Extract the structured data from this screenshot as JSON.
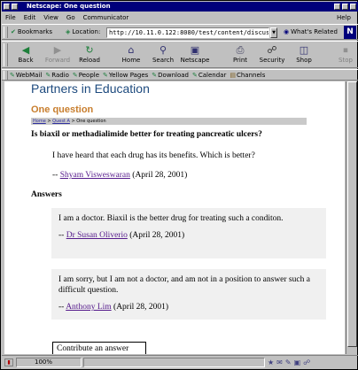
{
  "window": {
    "title": "Netscape: One question"
  },
  "menubar": {
    "items": [
      "File",
      "Edit",
      "View",
      "Go",
      "Communicator"
    ],
    "help": "Help"
  },
  "locationbar": {
    "bookmarks_label": "Bookmarks",
    "location_label": "Location:",
    "url": "http://10.11.0.122:8080/test/content/discus",
    "related_label": "What's Related"
  },
  "navtoolbar": {
    "buttons": [
      {
        "label": "Back",
        "icon": "back-arrow-icon",
        "enabled": true
      },
      {
        "label": "Forward",
        "icon": "forward-arrow-icon",
        "enabled": false
      },
      {
        "label": "Reload",
        "icon": "reload-icon",
        "enabled": true
      },
      {
        "label": "Home",
        "icon": "home-icon",
        "enabled": true
      },
      {
        "label": "Search",
        "icon": "search-icon",
        "enabled": true
      },
      {
        "label": "Netscape",
        "icon": "netscape-icon",
        "enabled": true
      },
      {
        "label": "Print",
        "icon": "print-icon",
        "enabled": true
      },
      {
        "label": "Security",
        "icon": "security-lock-icon",
        "enabled": true
      },
      {
        "label": "Shop",
        "icon": "shop-icon",
        "enabled": true
      },
      {
        "label": "Stop",
        "icon": "stop-icon",
        "enabled": false
      }
    ]
  },
  "personaltoolbar": {
    "links": [
      "WebMail",
      "Radio",
      "People",
      "Yellow Pages",
      "Download",
      "Calendar",
      "Channels"
    ]
  },
  "page": {
    "site_title": "Partners in Education",
    "heading": "One question",
    "breadcrumb": {
      "home": "Home",
      "sep1": " > ",
      "parent": "Quest A",
      "sep2": " > ",
      "current": "One question"
    },
    "question": {
      "title": "Is biaxil or methadialimide better for treating pancreatic ulcers?",
      "body": "I have heard that each drug has its benefits. Which is better?",
      "dash": "-- ",
      "author": "Shyam Visweswaran",
      "date": " (April 28, 2001)"
    },
    "answers_heading": "Answers",
    "answers": [
      {
        "text": "I am a doctor. Biaxil is the better drug for treating such a conditon.",
        "dash": "-- ",
        "author": "Dr Susan Oliverio",
        "date": " (April 28, 2001)"
      },
      {
        "text": "I am sorry, but I am not a doctor, and am not in a position to answer such a difficult question.",
        "dash": "-- ",
        "author": "Anthony Lim",
        "date": " (April 28, 2001)"
      }
    ],
    "contribute_label": "Contribute an answer"
  },
  "statusbar": {
    "zoom": "100%"
  },
  "colors": {
    "title_bar": "#00007b",
    "site_title": "#1d4a7e",
    "page_heading": "#c87e2e",
    "link_visited": "#551a8b",
    "answer_bg": "#f0f0f0"
  }
}
